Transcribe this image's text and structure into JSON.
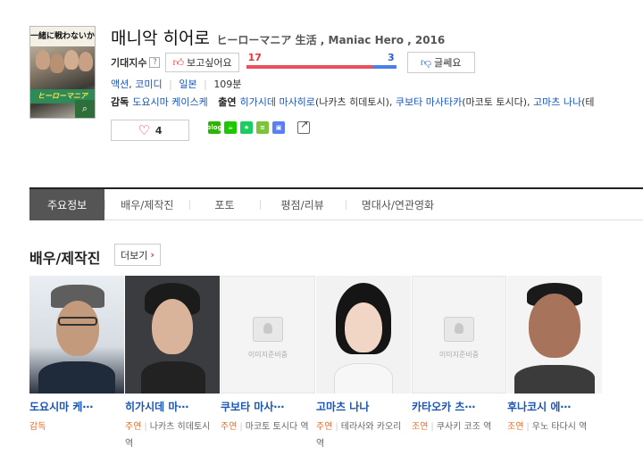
{
  "poster": {
    "top_text": "一緒に戦わないか",
    "band_text": "ヒーローマニア",
    "zoom_icon": "search-icon"
  },
  "title": {
    "main": "매니악 히어로",
    "sub": "ヒーローマニア 生活 , Maniac Hero , 2016"
  },
  "rating": {
    "label": "기대지수",
    "help": "?",
    "like_label": "보고싶어요",
    "up_count": "17",
    "down_count": "3",
    "up_fraction": 0.85,
    "dislike_label": "글쎄요"
  },
  "genres": [
    "액션",
    "코미디"
  ],
  "country": "일본",
  "runtime": "109분",
  "credits": {
    "director_label": "감독",
    "director": "도요시마 케이스케",
    "cast_label": "출연",
    "cast": [
      {
        "name": "히가시데 마사히로",
        "role": "(나카츠 히데토시), "
      },
      {
        "name": "쿠보타 마사타카",
        "role": "(마코토 토시다), "
      },
      {
        "name": "고마츠 나나",
        "role": "(테"
      }
    ]
  },
  "favorite": {
    "count": "4"
  },
  "share": [
    "blog",
    "cafe",
    "bookmark",
    "memo",
    "shortcut"
  ],
  "tabs": [
    "주요정보",
    "배우/제작진",
    "포토",
    "평점/리뷰",
    "명대사/연관영화"
  ],
  "section": {
    "title": "배우/제작진",
    "more_label": "더보기"
  },
  "no_image_text": "이미지준비중",
  "people": [
    {
      "name": "도요시마 케⋯",
      "role": "감독",
      "character": ""
    },
    {
      "name": "히가시데 마⋯",
      "role": "주연",
      "character": "나카츠 히데토시 역"
    },
    {
      "name": "쿠보타 마사⋯",
      "role": "주연",
      "character": "마코토 토시다 역"
    },
    {
      "name": "고마츠 나나",
      "role": "주연",
      "character": "테라사와 카오리 역"
    },
    {
      "name": "카타오카 츠⋯",
      "role": "조연",
      "character": "쿠사키 코조 역"
    },
    {
      "name": "후나코시 에⋯",
      "role": "조연",
      "character": "우노 타다시 역"
    }
  ]
}
